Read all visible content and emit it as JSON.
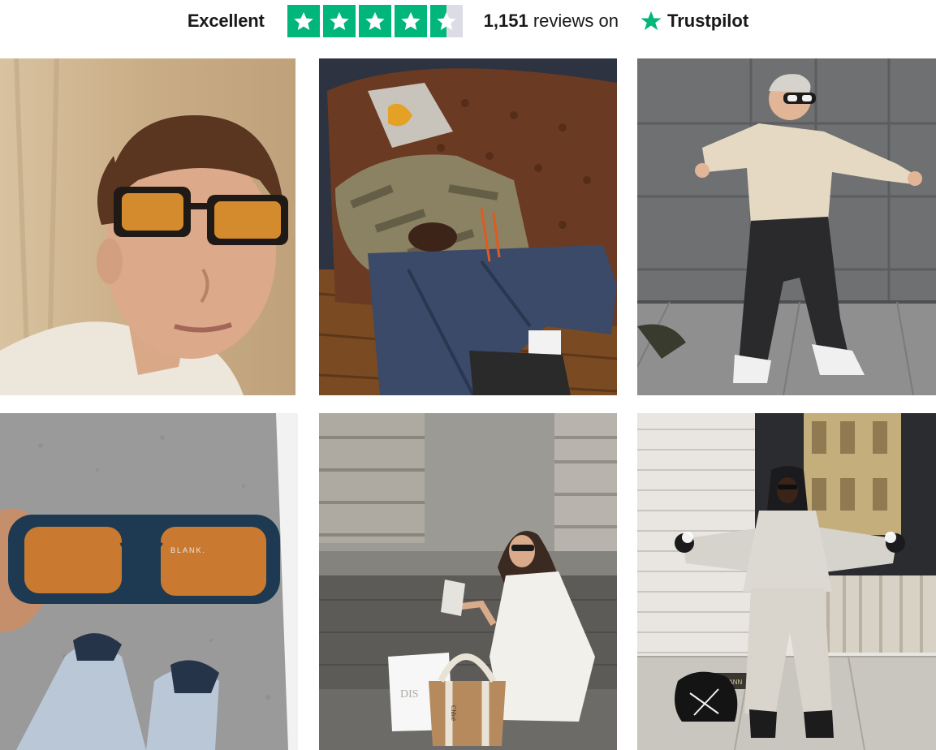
{
  "trustpilot": {
    "rating_word": "Excellent",
    "stars_total": 5,
    "stars_filled": 4.5,
    "review_count": "1,151",
    "reviews_suffix": "reviews on",
    "brand": "Trustpilot",
    "colors": {
      "star_green": "#00b67a",
      "star_empty": "#dcdce6",
      "text": "#191919"
    }
  },
  "gallery": {
    "items": [
      {
        "icon": "photo-portrait-sunglasses"
      },
      {
        "icon": "photo-lounging-sofa"
      },
      {
        "icon": "photo-wall-pose"
      },
      {
        "icon": "photo-held-sunglasses",
        "frame_text": "BLANK."
      },
      {
        "icon": "photo-street-shopping",
        "bag_text": "Chloé",
        "box_text": "DIS"
      },
      {
        "icon": "photo-hooded-figure",
        "sign_text": "RMANN"
      }
    ]
  }
}
